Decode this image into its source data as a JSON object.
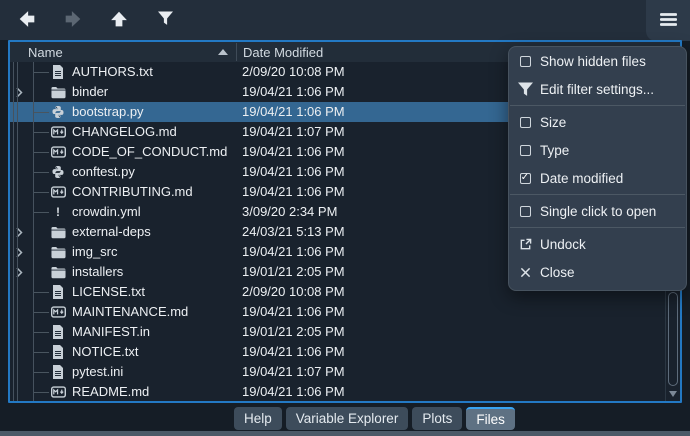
{
  "colors": {
    "selection": "#346792",
    "focus_border": "#2379c4",
    "tab_accent": "#38a3f1",
    "menu_background": "#333f4e",
    "panel_background": "#19222d"
  },
  "toolbar": {
    "buttons": [
      {
        "name": "back-button",
        "icon": "arrow-left-icon",
        "enabled": true
      },
      {
        "name": "forward-button",
        "icon": "arrow-right-icon",
        "enabled": false
      },
      {
        "name": "up-button",
        "icon": "arrow-up-icon",
        "enabled": true
      },
      {
        "name": "filter-files-button",
        "icon": "filter-icon",
        "enabled": true
      }
    ],
    "menu_button": {
      "name": "options-menu-button",
      "icon": "hamburger-icon"
    }
  },
  "file_list": {
    "columns": [
      {
        "label": "Name",
        "sort": "ascending"
      },
      {
        "label": "Date Modified"
      }
    ],
    "rows": [
      {
        "name": "AUTHORS.txt",
        "date": "2/09/20 10:08 PM",
        "icon": "text-file-icon",
        "kind": "file"
      },
      {
        "name": "binder",
        "date": "19/04/21 1:06 PM",
        "icon": "folder-icon",
        "kind": "folder"
      },
      {
        "name": "bootstrap.py",
        "date": "19/04/21 1:06 PM",
        "icon": "python-file-icon",
        "kind": "file",
        "selected": true
      },
      {
        "name": "CHANGELOG.md",
        "date": "19/04/21 1:07 PM",
        "icon": "markdown-file-icon",
        "kind": "file"
      },
      {
        "name": "CODE_OF_CONDUCT.md",
        "date": "19/04/21 1:06 PM",
        "icon": "markdown-file-icon",
        "kind": "file"
      },
      {
        "name": "conftest.py",
        "date": "19/04/21 1:06 PM",
        "icon": "python-file-icon",
        "kind": "file"
      },
      {
        "name": "CONTRIBUTING.md",
        "date": "19/04/21 1:06 PM",
        "icon": "markdown-file-icon",
        "kind": "file"
      },
      {
        "name": "crowdin.yml",
        "date": "3/09/20 2:34 PM",
        "icon": "exclamation-file-icon",
        "kind": "file"
      },
      {
        "name": "external-deps",
        "date": "24/03/21 5:13 PM",
        "icon": "folder-icon",
        "kind": "folder"
      },
      {
        "name": "img_src",
        "date": "19/04/21 1:06 PM",
        "icon": "folder-icon",
        "kind": "folder"
      },
      {
        "name": "installers",
        "date": "19/01/21 2:05 PM",
        "icon": "folder-icon",
        "kind": "folder"
      },
      {
        "name": "LICENSE.txt",
        "date": "2/09/20 10:08 PM",
        "icon": "text-file-icon",
        "kind": "file"
      },
      {
        "name": "MAINTENANCE.md",
        "date": "19/04/21 1:06 PM",
        "icon": "markdown-file-icon",
        "kind": "file"
      },
      {
        "name": "MANIFEST.in",
        "date": "19/01/21 2:05 PM",
        "icon": "text-file-icon",
        "kind": "file"
      },
      {
        "name": "NOTICE.txt",
        "date": "19/04/21 1:06 PM",
        "icon": "text-file-icon",
        "kind": "file"
      },
      {
        "name": "pytest.ini",
        "date": "19/04/21 1:07 PM",
        "icon": "text-file-icon",
        "kind": "file"
      },
      {
        "name": "README.md",
        "date": "19/04/21 1:06 PM",
        "icon": "markdown-file-icon",
        "kind": "file"
      }
    ]
  },
  "context_menu": {
    "items": [
      {
        "label": "Show hidden files",
        "control": "checkbox",
        "checked": false
      },
      {
        "label": "Edit filter settings...",
        "icon": "filter-icon"
      },
      {
        "separator": true
      },
      {
        "label": "Size",
        "control": "checkbox",
        "checked": false
      },
      {
        "label": "Type",
        "control": "checkbox",
        "checked": false
      },
      {
        "label": "Date modified",
        "control": "checkbox",
        "checked": true
      },
      {
        "separator": true
      },
      {
        "label": "Single click to open",
        "control": "checkbox",
        "checked": false
      },
      {
        "separator": true
      },
      {
        "label": "Undock",
        "icon": "undock-icon"
      },
      {
        "label": "Close",
        "icon": "close-icon"
      }
    ]
  },
  "tabs": {
    "items": [
      {
        "label": "Help"
      },
      {
        "label": "Variable Explorer"
      },
      {
        "label": "Plots"
      },
      {
        "label": "Files"
      }
    ],
    "active_label": "Files"
  }
}
